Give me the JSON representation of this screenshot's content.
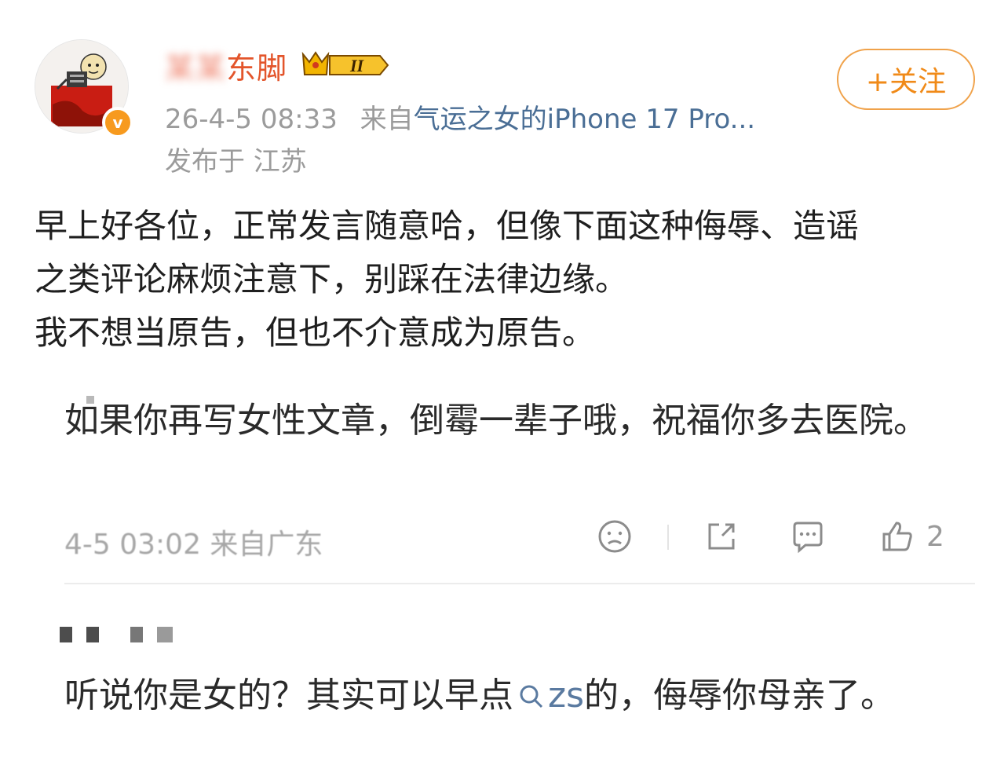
{
  "post": {
    "author": {
      "name_visible": "东脚",
      "name_obscured": "某某",
      "verified_mark": "v",
      "vip_level": "II"
    },
    "timestamp": "26-4-5 08:33",
    "source_prefix": "来自",
    "source_device": "气运之女的iPhone 17 Pro...",
    "location": "发布于 江苏",
    "follow_label": "+关注",
    "body_lines": [
      "早上好各位，正常发言随意哈，但像下面这种侮辱、造谣",
      "之类评论麻烦注意下，别踩在法律边缘。",
      "我不想当原告，但也不介意成为原告。"
    ]
  },
  "screenshot": {
    "comment_1": {
      "text": "如果你再写女性文章，倒霉一辈子哦，祝福你多去医院。",
      "meta": "4-5 03:02 来自广东",
      "like_count": "2",
      "icons": [
        "sad-face-icon",
        "share-icon",
        "comment-icon",
        "thumbs-up-icon"
      ]
    },
    "comment_2": {
      "text_before": "听说你是女的？其实可以早点",
      "search_link": "zs",
      "text_after": "的，侮辱你母亲了。"
    }
  },
  "colors": {
    "accent_orange": "#f08a18",
    "username_red": "#e3552b",
    "link_blue": "#4a6e95",
    "meta_gray": "#9b9b9b"
  }
}
